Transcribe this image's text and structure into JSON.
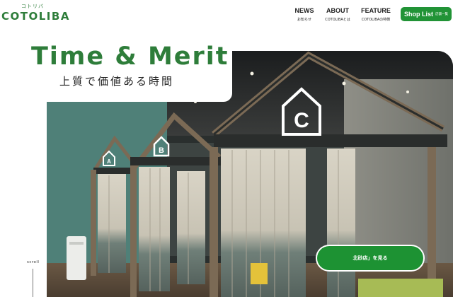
{
  "logo": {
    "ruby": "コトリバ",
    "wordmark": "COTOLIBA"
  },
  "nav": {
    "items": [
      {
        "label": "NEWS",
        "sub": "お知らせ"
      },
      {
        "label": "ABOUT",
        "sub": "COTOLIBAとは"
      },
      {
        "label": "FEATURE",
        "sub": "COTOLIBAの特徴"
      }
    ]
  },
  "shop_button": {
    "label": "Shop List",
    "sub": "店舗一覧"
  },
  "hero": {
    "title": "Time & Merit",
    "subtitle": "上質で価値ある時間",
    "booth_letters": [
      "A",
      "B",
      "C"
    ]
  },
  "scroll": {
    "label": "scroll"
  },
  "cta": {
    "label": "北砂店」を見る"
  },
  "colors": {
    "brand_green": "#2e7d3a",
    "button_green": "#219336"
  }
}
